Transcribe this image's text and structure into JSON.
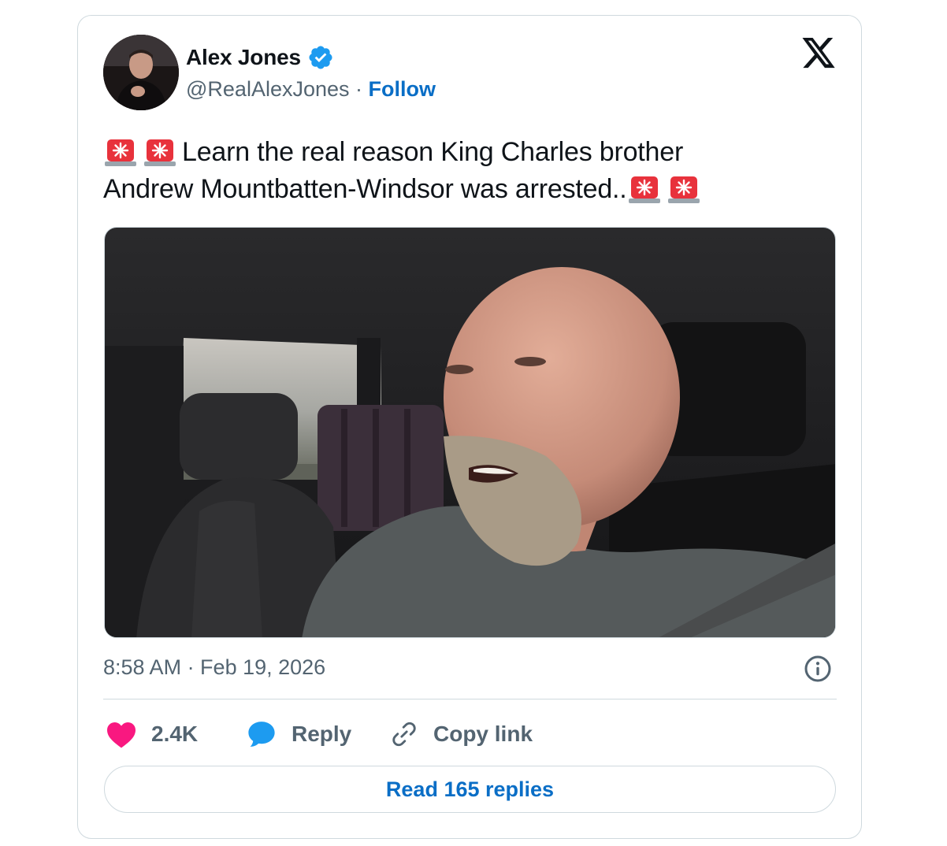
{
  "author": {
    "name": "Alex Jones",
    "handle": "@RealAlexJones",
    "separator": "·",
    "follow_label": "Follow"
  },
  "tweet": {
    "text_line1": "Learn the real reason King Charles brother",
    "text_line2": "Andrew Mountbatten-Windsor was arrested..",
    "emoji": "police-car-light-icon"
  },
  "meta": {
    "timestamp": "8:58 AM · Feb 19, 2026"
  },
  "actions": {
    "like_count": "2.4K",
    "reply_label": "Reply",
    "copy_label": "Copy link"
  },
  "footer": {
    "read_replies_label": "Read 165 replies"
  },
  "colors": {
    "link_blue": "#0a6ec6",
    "verified_blue": "#1d9bf0",
    "like_pink": "#f91880",
    "reply_blue": "#1d9bf0",
    "muted_gray": "#536471",
    "border": "#cfd9de"
  }
}
